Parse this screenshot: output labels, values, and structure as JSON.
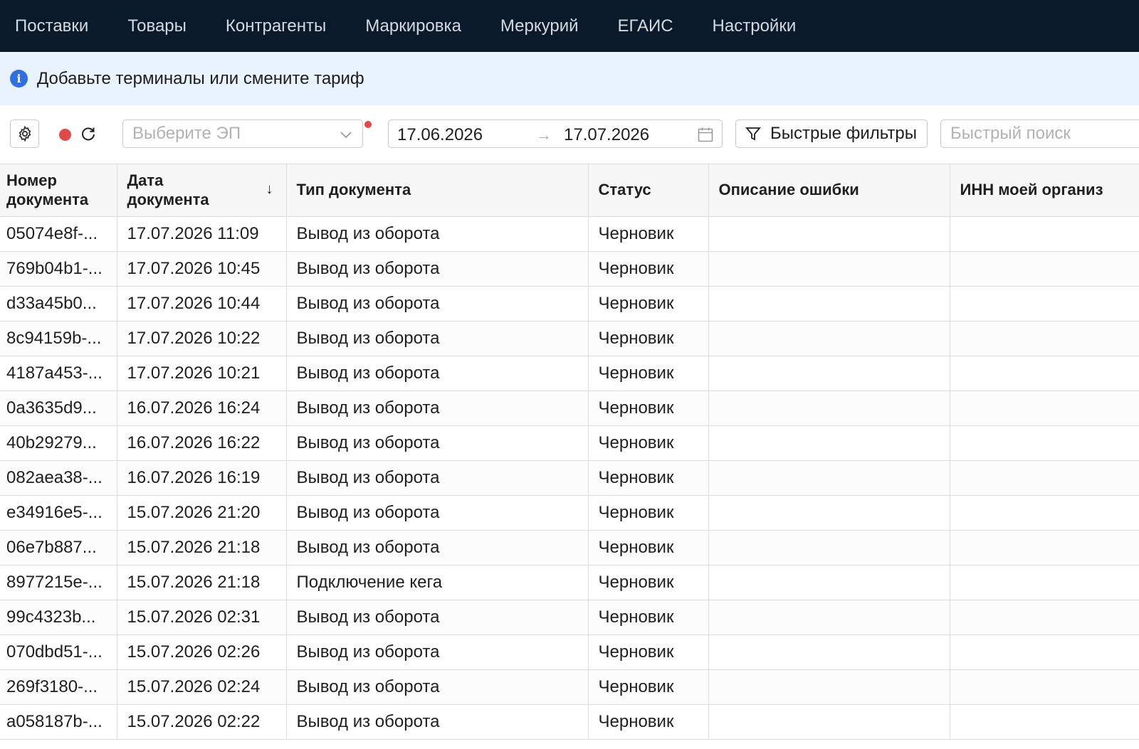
{
  "nav": {
    "items": [
      {
        "label": "Поставки"
      },
      {
        "label": "Товары"
      },
      {
        "label": "Контрагенты"
      },
      {
        "label": "Маркировка"
      },
      {
        "label": "Меркурий"
      },
      {
        "label": "ЕГАИС"
      },
      {
        "label": "Настройки"
      }
    ]
  },
  "banner": {
    "icon": "info-icon",
    "text": "Добавьте терминалы или смените тариф"
  },
  "toolbar": {
    "ep_select_placeholder": "Выберите ЭП",
    "date_from": "17.06.2026",
    "date_to": "17.07.2026",
    "quick_filters_label": "Быстрые фильтры",
    "quick_search_placeholder": "Быстрый поиск"
  },
  "table": {
    "columns": [
      {
        "label": "Номер документа"
      },
      {
        "label": "Дата документа"
      },
      {
        "label": "Тип документа"
      },
      {
        "label": "Статус"
      },
      {
        "label": "Описание ошибки"
      },
      {
        "label": "ИНН моей организ"
      }
    ],
    "header_lines": {
      "number_1": "Номер",
      "number_2": "документа",
      "date_1": "Дата",
      "date_2": "документа"
    },
    "rows": [
      {
        "number": "05074e8f-...",
        "date": "17.07.2026 11:09",
        "type": "Вывод из оборота",
        "status": "Черновик"
      },
      {
        "number": "769b04b1-...",
        "date": "17.07.2026 10:45",
        "type": "Вывод из оборота",
        "status": "Черновик"
      },
      {
        "number": "d33a45b0...",
        "date": "17.07.2026 10:44",
        "type": "Вывод из оборота",
        "status": "Черновик"
      },
      {
        "number": "8c94159b-...",
        "date": "17.07.2026 10:22",
        "type": "Вывод из оборота",
        "status": "Черновик"
      },
      {
        "number": "4187a453-...",
        "date": "17.07.2026 10:21",
        "type": "Вывод из оборота",
        "status": "Черновик"
      },
      {
        "number": "0a3635d9...",
        "date": "16.07.2026 16:24",
        "type": "Вывод из оборота",
        "status": "Черновик"
      },
      {
        "number": "40b29279...",
        "date": "16.07.2026 16:22",
        "type": "Вывод из оборота",
        "status": "Черновик"
      },
      {
        "number": "082aea38-...",
        "date": "16.07.2026 16:19",
        "type": "Вывод из оборота",
        "status": "Черновик"
      },
      {
        "number": "e34916e5-...",
        "date": "15.07.2026 21:20",
        "type": "Вывод из оборота",
        "status": "Черновик"
      },
      {
        "number": "06e7b887...",
        "date": "15.07.2026 21:18",
        "type": "Вывод из оборота",
        "status": "Черновик"
      },
      {
        "number": "8977215e-...",
        "date": "15.07.2026 21:18",
        "type": "Подключение кега",
        "status": "Черновик"
      },
      {
        "number": "99c4323b...",
        "date": "15.07.2026 02:31",
        "type": "Вывод из оборота",
        "status": "Черновик"
      },
      {
        "number": "070dbd51-...",
        "date": "15.07.2026 02:26",
        "type": "Вывод из оборота",
        "status": "Черновик"
      },
      {
        "number": "269f3180-...",
        "date": "15.07.2026 02:24",
        "type": "Вывод из оборота",
        "status": "Черновик"
      },
      {
        "number": "a058187b-...",
        "date": "15.07.2026 02:22",
        "type": "Вывод из оборота",
        "status": "Черновик"
      }
    ]
  },
  "colors": {
    "nav_bg": "#0b1a2b",
    "banner_bg": "#e9f3fd",
    "info_icon": "#2f6fe0",
    "status_dot": "#e24a4a"
  }
}
